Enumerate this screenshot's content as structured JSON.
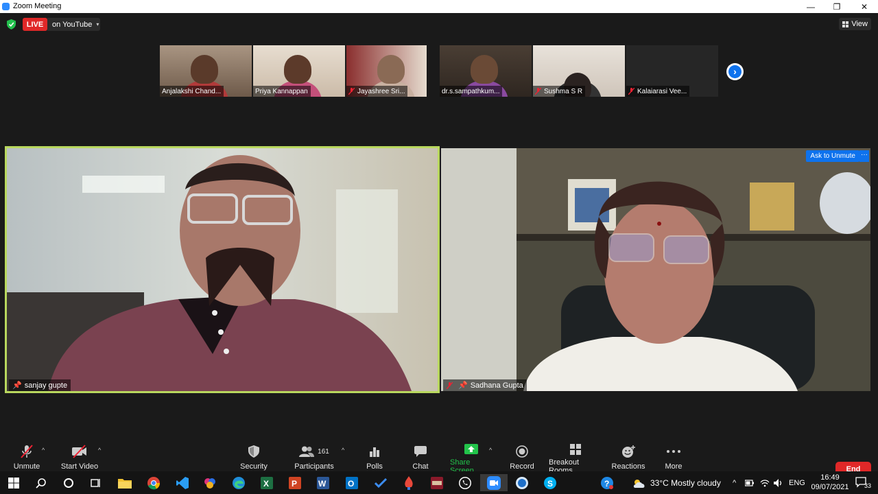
{
  "window": {
    "title": "Zoom Meeting",
    "minimize": "—",
    "maximize": "❐",
    "close": "✕"
  },
  "live": {
    "badge": "LIVE",
    "destination": "on YouTube",
    "caret": "▾"
  },
  "view": {
    "label": "View"
  },
  "gallery": [
    {
      "name": "Anjalakshi Chand...",
      "muted": false,
      "color": "#8a7565"
    },
    {
      "name": "Priya Kannappan",
      "muted": false,
      "color": "#c8b8a8"
    },
    {
      "name": "Jayashree Sri...",
      "muted": true,
      "color": "#b05050"
    },
    {
      "name": "dr.s.sampathkum...",
      "muted": false,
      "color": "#6c5a4c"
    },
    {
      "name": "Sushma S R",
      "muted": true,
      "color": "#d6cabf"
    },
    {
      "name": "Kalaiarasi Vee...",
      "muted": true,
      "color": "#2a2a2a"
    }
  ],
  "next_arrow": "›",
  "speakers": {
    "left": {
      "name": "sanjay gupte"
    },
    "right": {
      "name": "Sadhana Gupta",
      "ask_unmute": "Ask to Unmute",
      "more": "···"
    }
  },
  "toolbar": {
    "unmute": "Unmute",
    "start_video": "Start Video",
    "security": "Security",
    "participants": "Participants",
    "participants_count": "161",
    "polls": "Polls",
    "chat": "Chat",
    "share_screen": "Share Screen",
    "record": "Record",
    "breakout_rooms": "Breakout Rooms",
    "reactions": "Reactions",
    "more": "More",
    "end": "End",
    "caret": "^"
  },
  "taskbar": {
    "weather": "33°C  Mostly cloudy",
    "lang": "ENG",
    "time": "16:49",
    "date": "09/07/2021",
    "notifications": "33",
    "tray_caret": "^",
    "apps": [
      "start",
      "search",
      "cortana",
      "task-view",
      "file-explorer",
      "chrome",
      "vscode",
      "photos",
      "edge",
      "excel",
      "powerpoint",
      "word",
      "outlook",
      "todo",
      "paint",
      "winrar",
      "whatsapp",
      "zoom",
      "skype-alt",
      "skype",
      "help"
    ]
  },
  "colors": {
    "accent": "#0e72ed",
    "end": "#e02828",
    "speaker_border": "#b9d85e",
    "share_green": "#22c34a"
  }
}
